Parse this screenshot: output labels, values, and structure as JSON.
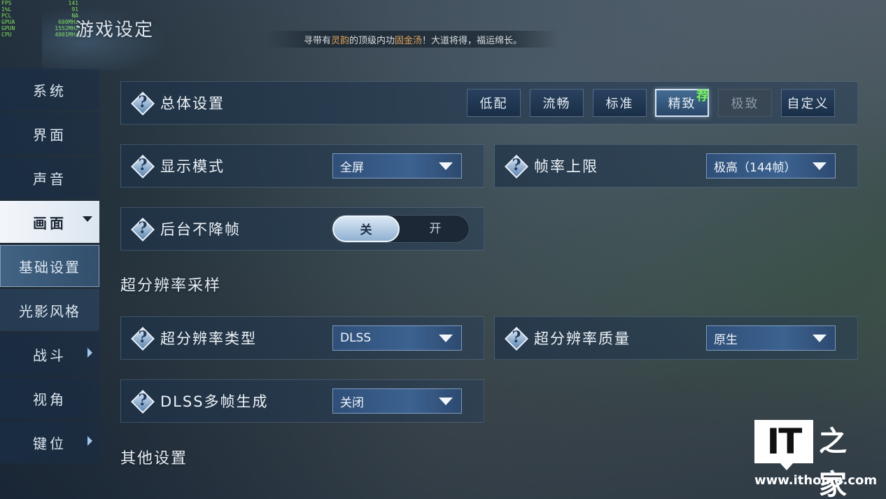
{
  "overlay": {
    "fps_rows": [
      {
        "label": "FPS",
        "value": "141"
      },
      {
        "label": "1%L",
        "value": "91"
      },
      {
        "label": "PCL",
        "value": "NA"
      },
      {
        "label": "GPUA",
        "value": "600MHz"
      },
      {
        "label": "GPUN",
        "value": "1552MHz"
      },
      {
        "label": "CPU",
        "value": "4001MHz"
      }
    ]
  },
  "header": {
    "title": "游戏设定",
    "tip_prefix": "寻带有",
    "tip_hl1": "灵韵",
    "tip_mid": "的顶级内功",
    "tip_hl2": "固金汤",
    "tip_suffix": "！大道将得，福运绵长。"
  },
  "sidebar": {
    "items": [
      {
        "label": "系统"
      },
      {
        "label": "界面"
      },
      {
        "label": "声音"
      },
      {
        "label": "画面"
      },
      {
        "label": "基础设置"
      },
      {
        "label": "光影风格"
      },
      {
        "label": "战斗"
      },
      {
        "label": "视角"
      },
      {
        "label": "键位"
      }
    ]
  },
  "overall": {
    "label": "总体设置",
    "options": [
      "低配",
      "流畅",
      "标准",
      "精致",
      "极致",
      "自定义"
    ],
    "selected": "精致",
    "recommend_badge": "荐",
    "disabled": "极致"
  },
  "display_mode": {
    "label": "显示模式",
    "value": "全屏"
  },
  "frame_limit": {
    "label": "帧率上限",
    "value": "极高（144帧）"
  },
  "background_fps": {
    "label": "后台不降帧",
    "on_label": "关",
    "off_label": "开",
    "selected": "关"
  },
  "upscaling": {
    "section_title": "超分辨率采样",
    "type": {
      "label": "超分辨率类型",
      "value": "DLSS"
    },
    "quality": {
      "label": "超分辨率质量",
      "value": "原生"
    },
    "frame_gen": {
      "label": "DLSS多帧生成",
      "value": "关闭"
    }
  },
  "other": {
    "section_title": "其他设置"
  },
  "watermark": {
    "logo": "IT",
    "char": "之家",
    "url": "www.ithome.com"
  },
  "colors": {
    "accent_green": "#7cf06e",
    "tip_highlight": "#e1a25c"
  }
}
